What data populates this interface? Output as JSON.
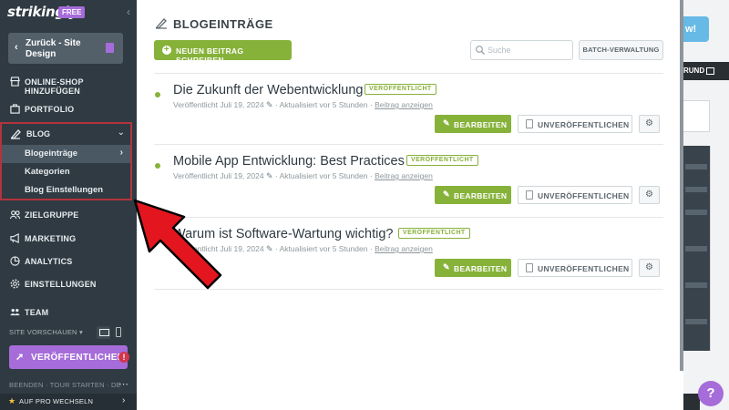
{
  "app": {
    "logo": "strikingly",
    "plan_badge": "FREE",
    "back_label": "Zurück - Site Design"
  },
  "sidebar": {
    "items": [
      {
        "label": "ONLINE-SHOP HINZUFÜGEN",
        "icon": "store-icon"
      },
      {
        "label": "PORTFOLIO",
        "icon": "portfolio-icon"
      },
      {
        "label": "BLOG",
        "icon": "blog-icon"
      },
      {
        "label": "ZIELGRUPPE",
        "icon": "audience-icon"
      },
      {
        "label": "MARKETING",
        "icon": "megaphone-icon"
      },
      {
        "label": "ANALYTICS",
        "icon": "analytics-icon"
      },
      {
        "label": "EINSTELLUNGEN",
        "icon": "gear-icon"
      },
      {
        "label": "TEAM",
        "icon": "team-icon"
      }
    ],
    "blog_subitems": [
      {
        "label": "Blogeinträge",
        "active": true
      },
      {
        "label": "Kategorien",
        "active": false
      },
      {
        "label": "Blog Einstellungen",
        "active": false
      }
    ],
    "site_preview": "SITE VORSCHAUEN",
    "publish_label": "VERÖFFENTLICHEN",
    "publish_alert": "!",
    "footer_links": "BEENDEN · TOUR STARTEN · DE",
    "pro_upgrade": "AUF PRO WECHSELN"
  },
  "panel": {
    "title": "BLOGEINTRÄGE",
    "new_post_label": "NEUEN BEITRAG SCHREIBEN",
    "search_placeholder": "Suche",
    "batch_label": "BATCH-VERWALTUNG",
    "posts": [
      {
        "title": "Die Zukunft der Webentwicklung",
        "status": "VERÖFFENTLICHT",
        "published": "Veröffentlicht Juli 19, 2024",
        "updated": "Aktualisiert vor 5 Stunden",
        "view_link": "Beitrag anzeigen",
        "edit_label": "BEARBEITEN",
        "unpublish_label": "UNVERÖFFENTLICHEN"
      },
      {
        "title": "Mobile App Entwicklung: Best Practices",
        "status": "VERÖFFENTLICHT",
        "published": "Veröffentlicht Juli 19, 2024",
        "updated": "Aktualisiert vor 5 Stunden",
        "view_link": "Beitrag anzeigen",
        "edit_label": "BEARBEITEN",
        "unpublish_label": "UNVERÖFFENTLICHEN"
      },
      {
        "title": "Warum ist Software-Wartung wichtig?",
        "status": "VERÖFFENTLICHT",
        "published": "Veröffentlicht Juli 19, 2024",
        "updated": "Aktualisiert vor 5 Stunden",
        "view_link": "Beitrag anzeigen",
        "edit_label": "BEARBEITEN",
        "unpublish_label": "UNVERÖFFENTLICHEN"
      }
    ]
  },
  "background": {
    "pill_text": "w!",
    "dark_button_text": "RUND",
    "help_label": "?"
  },
  "colors": {
    "sidebar_bg": "#2f3a42",
    "accent_green": "#87b23a",
    "accent_purple": "#a66cd9",
    "highlight_red": "#b3343c",
    "arrow_red": "#e3161f"
  }
}
